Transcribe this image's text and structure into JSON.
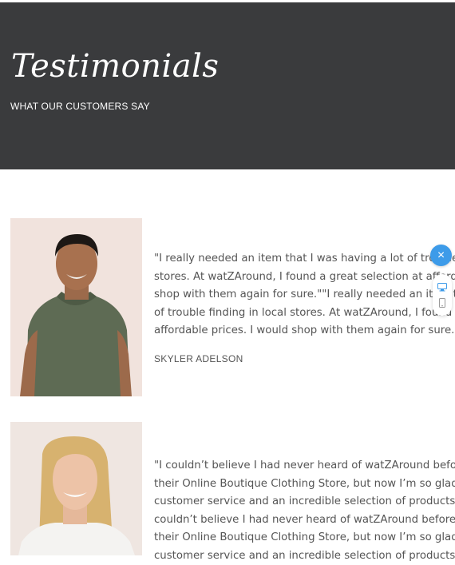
{
  "header": {
    "title": "Testimonials",
    "subtitle": "WHAT OUR CUSTOMERS SAY"
  },
  "testimonials": [
    {
      "lines": [
        "\"I really needed an item that I was having a lot of trouble finding in local",
        "stores. At watZAround, I found a great selection at affordable prices. I would",
        "shop with them again for sure.\"\"I really needed an item that I was having a lot",
        "of trouble finding in local stores. At watZAround, I found a great selection at",
        "affordable prices. I would shop with them again for sure.\""
      ],
      "author": "SKYLER ADELSON"
    },
    {
      "lines": [
        "\"I couldn’t believe I had never heard of watZAround before I stumbled upon",
        "their Online Boutique Clothing Store, but now I’m so glad I did. They have great",
        "customer service and an incredible selection of products.\"\"I",
        "couldn’t believe I had never heard of watZAround before I stumbled upon",
        "their Online Boutique Clothing Store, but now I’m so glad I did. They have great",
        "customer service and an incredible selection of products.\""
      ]
    }
  ],
  "widget": {
    "close_icon": "×",
    "icons": [
      "close-icon",
      "desktop-icon",
      "mobile-icon"
    ]
  }
}
